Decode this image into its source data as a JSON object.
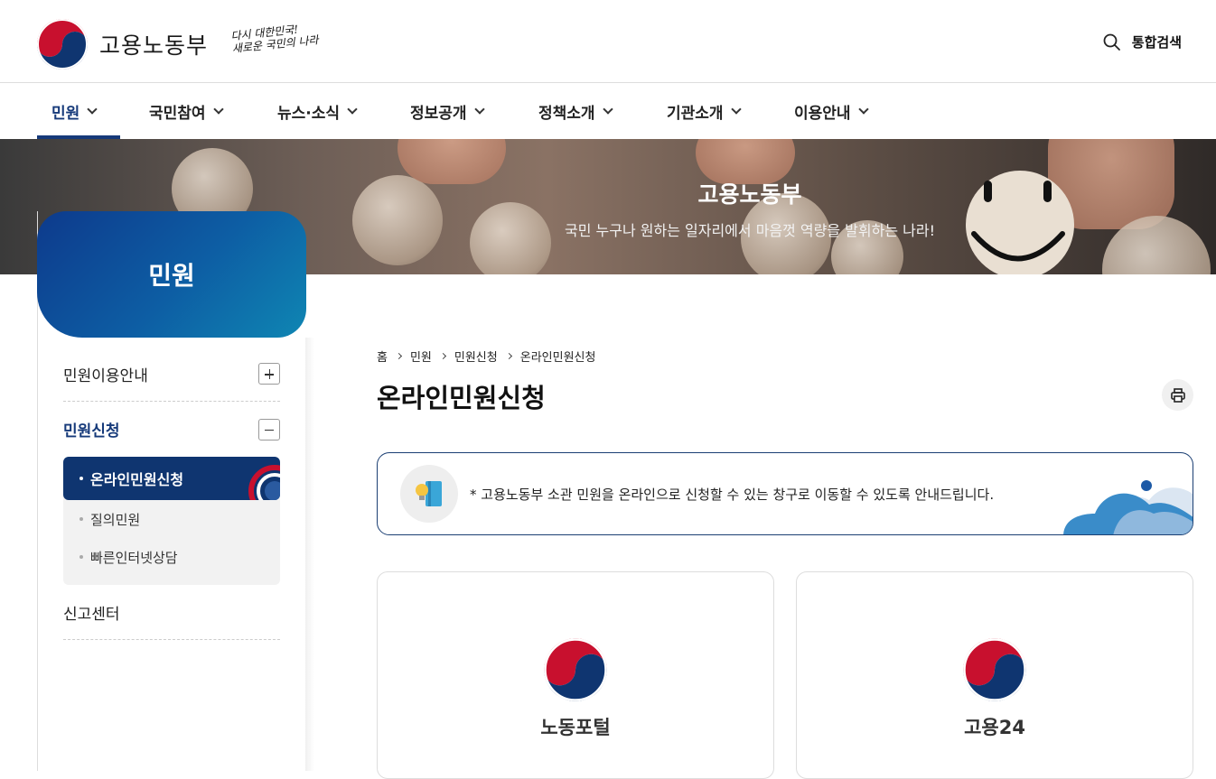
{
  "header": {
    "ministry_name": "고용노동부",
    "slogan_line1": "다시 대한민국!",
    "slogan_line2": "새로운 국민의 나라",
    "search_label": "통합검색"
  },
  "gnb": [
    {
      "label": "민원"
    },
    {
      "label": "국민참여"
    },
    {
      "label": "뉴스·소식"
    },
    {
      "label": "정보공개"
    },
    {
      "label": "정책소개"
    },
    {
      "label": "기관소개"
    },
    {
      "label": "이용안내"
    }
  ],
  "banner": {
    "title": "고용노동부",
    "subtitle": "국민 누구나 원하는 일자리에서 마음껏 역량을 발휘하는 나라!"
  },
  "lnb": {
    "title": "민원",
    "items": [
      {
        "label": "민원이용안내"
      },
      {
        "label": "민원신청"
      },
      {
        "label": "신고센터"
      }
    ],
    "sub_items": [
      {
        "label": "온라인민원신청"
      },
      {
        "label": "질의민원"
      },
      {
        "label": "빠른인터넷상담"
      }
    ]
  },
  "breadcrumb": [
    "홈",
    "민원",
    "민원신청",
    "온라인민원신청"
  ],
  "page_title": "온라인민원신청",
  "notice": "* 고용노동부 소관 민원을 온라인으로 신청할 수 있는 창구로 이동할 수 있도록 안내드립니다.",
  "cards": [
    {
      "label": "노동포털"
    },
    {
      "label": "고용24"
    }
  ],
  "colors": {
    "primary_navy": "#163a7a",
    "taegeuk_red": "#c8102e",
    "taegeuk_blue": "#0f3570"
  }
}
